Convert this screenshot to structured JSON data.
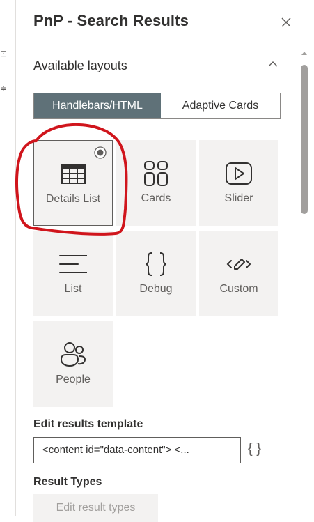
{
  "panel": {
    "title": "PnP - Search Results",
    "section_title": "Available layouts"
  },
  "layout_type_toggle": {
    "options": [
      "Handlebars/HTML",
      "Adaptive Cards"
    ],
    "selected": "Handlebars/HTML"
  },
  "layouts": [
    {
      "label": "Details List",
      "icon": "grid-table-icon",
      "selected": true
    },
    {
      "label": "Cards",
      "icon": "cards-grid-icon",
      "selected": false
    },
    {
      "label": "Slider",
      "icon": "play-slider-icon",
      "selected": false
    },
    {
      "label": "List",
      "icon": "list-lines-icon",
      "selected": false
    },
    {
      "label": "Debug",
      "icon": "curly-braces-icon",
      "selected": false
    },
    {
      "label": "Custom",
      "icon": "code-pen-icon",
      "selected": false
    },
    {
      "label": "People",
      "icon": "people-icon",
      "selected": false
    }
  ],
  "template": {
    "label": "Edit results template",
    "value": "<content id=\"data-content\">    <..."
  },
  "result_types": {
    "label": "Result Types",
    "button_label": "Edit result types"
  },
  "colors": {
    "accent_toggle": "#5f7178",
    "tile_bg": "#f3f2f1",
    "annotation": "#d0151c"
  }
}
